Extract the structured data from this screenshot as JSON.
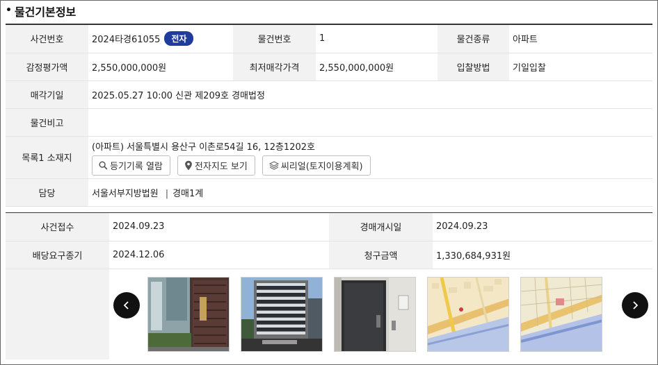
{
  "section": {
    "bullet": "•",
    "title": "물건기본정보"
  },
  "basic": {
    "row1": {
      "case_no_label": "사건번호",
      "case_no": "2024타경61055",
      "badge": "전자",
      "item_no_label": "물건번호",
      "item_no": "1",
      "item_type_label": "물건종류",
      "item_type": "아파트"
    },
    "row2": {
      "appraisal_label": "감정평가액",
      "appraisal": "2,550,000,000원",
      "min_price_label": "최저매각가격",
      "min_price": "2,550,000,000원",
      "bid_method_label": "입찰방법",
      "bid_method": "기일입찰"
    },
    "row3": {
      "sale_date_label": "매각기일",
      "sale_date": "2025.05.27 10:00 신관 제209호 경매법정"
    },
    "row4": {
      "remarks_label": "물건비고",
      "remarks": ""
    },
    "row5": {
      "location_label": "목록1 소재지",
      "location": "(아파트) 서울특별시 용산구 이촌로54길 16, 12층1202호",
      "buttons": {
        "registry": "등기기록 열람",
        "map": "전자지도 보기",
        "land_use": "씨리얼(토지이용계획)"
      }
    },
    "row6": {
      "manager_label": "담당",
      "court": "서울서부지방법원",
      "separator": "|",
      "division": "경매1계"
    }
  },
  "case_info": {
    "received_label": "사건접수",
    "received": "2024.09.23",
    "start_label": "경매개시일",
    "start": "2024.09.23",
    "dividend_label": "배당요구종기",
    "dividend": "2024.12.06",
    "claim_label": "청구금액",
    "claim": "1,330,684,931원"
  },
  "photos": [
    "building-entrance-photo",
    "apartment-exterior-photo",
    "unit-door-photo",
    "location-map-photo",
    "cadastral-map-photo"
  ],
  "colors": {
    "badge": "#1f3c9c",
    "header_bg": "#f2f2f2",
    "nav_button": "#111111"
  }
}
